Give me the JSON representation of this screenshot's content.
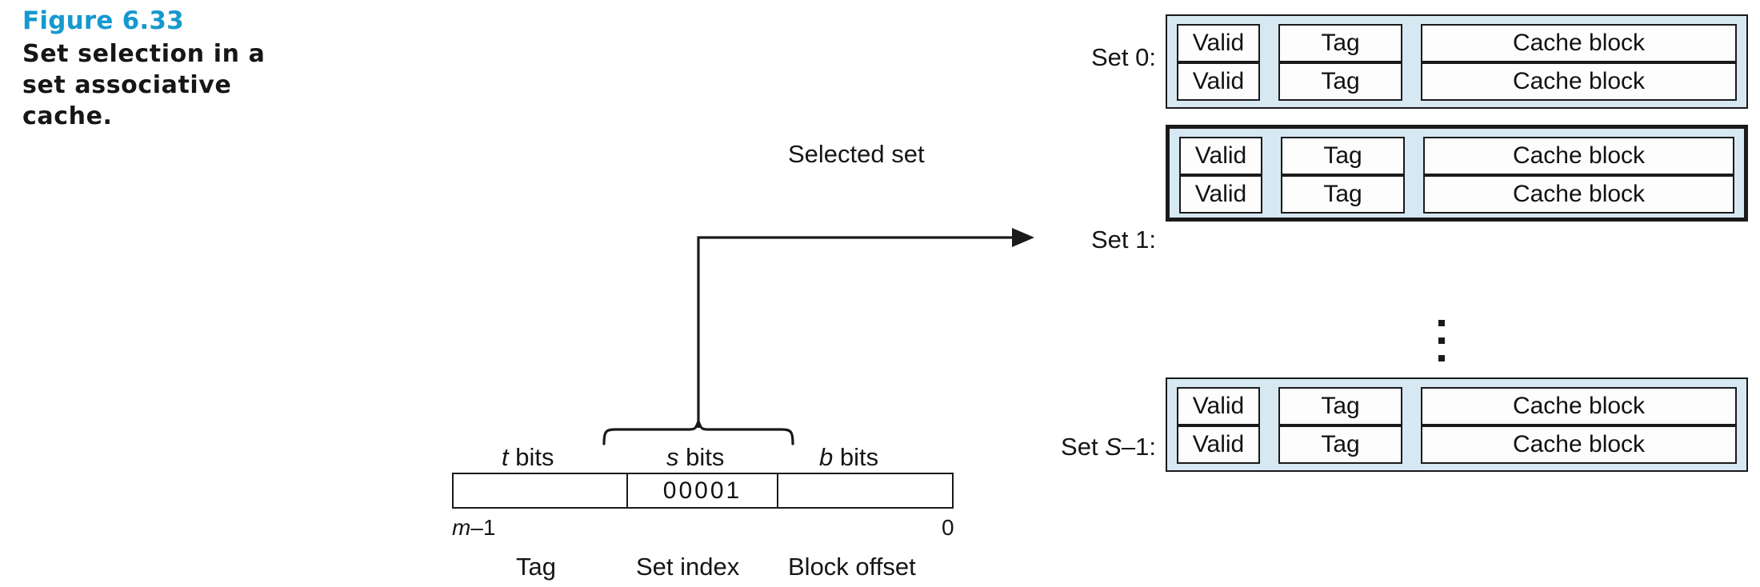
{
  "figure": {
    "number": "Figure 6.33",
    "caption": "Set selection in a set associative cache.",
    "accent_color": "#1699ce",
    "set_fill_color": "#d6e8f1",
    "line_color": "#1a1a1a"
  },
  "annotation": {
    "selected_set_label": "Selected set",
    "ellipsis_glyph": "vertical-ellipsis"
  },
  "cache": {
    "cell_headers": {
      "valid": "Valid",
      "tag": "Tag",
      "block": "Cache block"
    },
    "sets": [
      {
        "label": "Set 0:",
        "label_prefix": "Set ",
        "label_index": "0",
        "label_suffix": ":",
        "selected": false,
        "lines": [
          {
            "valid": "Valid",
            "tag": "Tag",
            "block": "Cache block"
          },
          {
            "valid": "Valid",
            "tag": "Tag",
            "block": "Cache block"
          }
        ]
      },
      {
        "label": "Set 1:",
        "label_prefix": "Set ",
        "label_index": "1",
        "label_suffix": ":",
        "selected": true,
        "lines": [
          {
            "valid": "Valid",
            "tag": "Tag",
            "block": "Cache block"
          },
          {
            "valid": "Valid",
            "tag": "Tag",
            "block": "Cache block"
          }
        ]
      },
      {
        "label": "Set S–1:",
        "label_prefix": "Set ",
        "label_index": "S",
        "label_suffix": "–1:",
        "selected": false,
        "lines": [
          {
            "valid": "Valid",
            "tag": "Tag",
            "block": "Cache block"
          },
          {
            "valid": "Valid",
            "tag": "Tag",
            "block": "Cache block"
          }
        ]
      }
    ]
  },
  "address": {
    "bit_widths": {
      "tag": "t bits",
      "tag_var": "t",
      "tag_word": " bits",
      "index": "s bits",
      "index_var": "s",
      "index_word": " bits",
      "offset": "b bits",
      "offset_var": "b",
      "offset_word": " bits"
    },
    "segment_values": {
      "tag": "",
      "index": "00001",
      "offset": ""
    },
    "endpoints": {
      "high": "m–1",
      "high_var": "m",
      "high_rest": "–1",
      "low": "0"
    },
    "field_names": {
      "tag": "Tag",
      "index": "Set index",
      "offset": "Block offset"
    }
  }
}
